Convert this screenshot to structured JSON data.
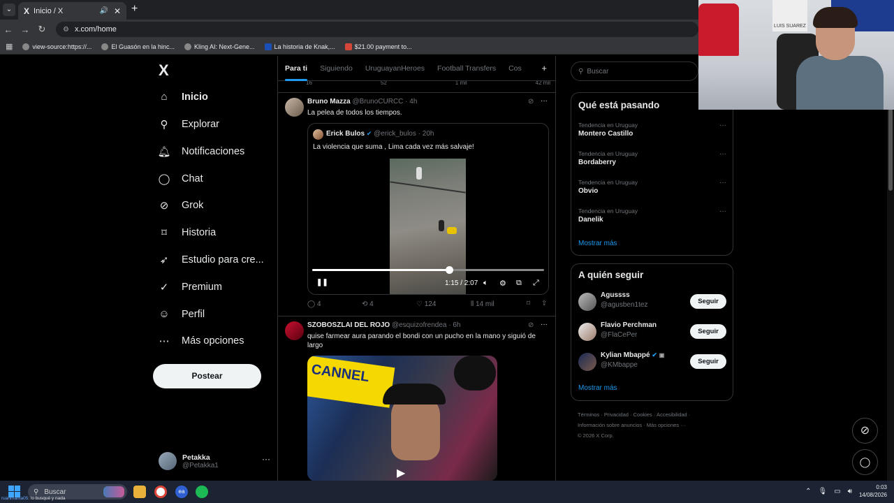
{
  "browser": {
    "tab_title": "Inicio / X",
    "tab_logo": "X",
    "new_tab": "+",
    "url": "x.com/home",
    "bookmarks": [
      {
        "label": "view-source:https://..."
      },
      {
        "label": "El Guasón en la hinc..."
      },
      {
        "label": "Kling AI: Next-Gene..."
      },
      {
        "label": "La historia de Knak,..."
      },
      {
        "label": "$21.00 payment to..."
      }
    ]
  },
  "sidebar": {
    "logo": "X",
    "items": [
      {
        "label": "Inicio",
        "icon": "home-icon"
      },
      {
        "label": "Explorar",
        "icon": "search-icon"
      },
      {
        "label": "Notificaciones",
        "icon": "bell-icon"
      },
      {
        "label": "Chat",
        "icon": "chat-icon"
      },
      {
        "label": "Grok",
        "icon": "grok-icon"
      },
      {
        "label": "Historia",
        "icon": "bookmark-icon"
      },
      {
        "label": "Estudio para cre...",
        "icon": "rocket-icon"
      },
      {
        "label": "Premium",
        "icon": "verified-icon"
      },
      {
        "label": "Perfil",
        "icon": "person-icon"
      },
      {
        "label": "Más opciones",
        "icon": "more-circle-icon"
      }
    ],
    "post_button": "Postear",
    "profile": {
      "name": "Petakka",
      "handle": "@Petakka1"
    }
  },
  "feed": {
    "tabs": [
      "Para ti",
      "Siguiendo",
      "UruguayanHeroes",
      "Football Transfers",
      "Cos"
    ],
    "prev_tweet_stats": {
      "replies": "16",
      "reposts": "52",
      "likes": "1 mil",
      "views": "42 mil"
    },
    "tweet1": {
      "name": "Bruno Mazza",
      "handle": "@BrunoCURCC · 4h",
      "text": "La pelea de todos los tiempos.",
      "quote": {
        "name": "Erick Bulos",
        "handle": "@erick_bulos · 20h",
        "text": "La violencia que suma , Lima cada vez más salvaje!"
      },
      "video": {
        "time": "1:15 / 2:07",
        "progress": 0.59
      },
      "stats": {
        "replies": "4",
        "reposts": "4",
        "likes": "124",
        "views": "14 mil"
      }
    },
    "tweet2": {
      "name": "SZOBOSZLAI DEL ROJO",
      "handle": "@esquizofrendea · 6h",
      "text": "quise farmear aura parando el bondi con un pucho en la mano y siguió de largo",
      "media_text": "CANNEL"
    }
  },
  "right": {
    "search_placeholder": "Buscar",
    "trends_title": "Qué está pasando",
    "trends": [
      {
        "context": "Tendencia en Uruguay",
        "topic": "Montero Castillo"
      },
      {
        "context": "Tendencia en Uruguay",
        "topic": "Bordaberry"
      },
      {
        "context": "Tendencia en Uruguay",
        "topic": "Obvio"
      },
      {
        "context": "Tendencia en Uruguay",
        "topic": "Danelik"
      }
    ],
    "show_more": "Mostrar más",
    "follow_title": "A quién seguir",
    "follow": [
      {
        "name": "Agussss",
        "handle": "@agusben1tez",
        "button": "Seguir"
      },
      {
        "name": "Flavio Perchman",
        "handle": "@FlaCePer",
        "button": "Seguir"
      },
      {
        "name": "Kylian Mbappé",
        "handle": "@KMbappe",
        "button": "Seguir"
      }
    ],
    "footer_line1": "Términos · Privacidad · Cookies · Accesibilidad ·",
    "footer_line2": "Información sobre anuncios · Más opciones ···",
    "footer_line3": "© 2026 X Corp."
  },
  "webcam": {
    "poster_text": "LUIS SUAREZ"
  },
  "taskbar": {
    "search_label": "Buscar",
    "overlay_user": "ruanmanta05",
    "overlay_text": ": lo busqué y nada",
    "time": "0:03",
    "date": "14/08/2026"
  }
}
